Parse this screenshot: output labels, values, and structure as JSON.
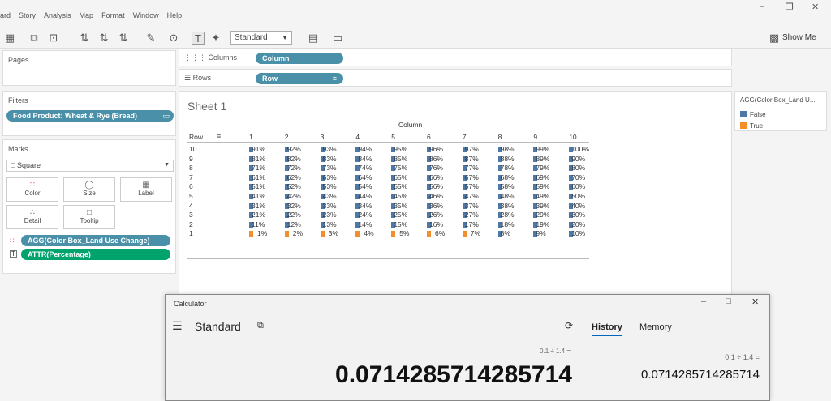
{
  "menu": [
    "ard",
    "Story",
    "Analysis",
    "Map",
    "Format",
    "Window",
    "Help"
  ],
  "toolbar": {
    "fit_value": "Standard",
    "show_me_label": "Show Me"
  },
  "pages": {
    "title": "Pages"
  },
  "shelves": {
    "columns_label": "Columns",
    "columns_pill": "Column",
    "rows_label": "Rows",
    "rows_pill": "Row"
  },
  "filters": {
    "title": "Filters",
    "pill": "Food Product: Wheat & Rye (Bread)"
  },
  "marks": {
    "title": "Marks",
    "type": "Square",
    "buttons": [
      "Color",
      "Size",
      "Label",
      "Detail",
      "Tooltip"
    ],
    "color_pill": "AGG(Color Box_Land Use Change)",
    "label_pill": "ATTR(Percentage)"
  },
  "sheet": {
    "title": "Sheet 1",
    "column_header": "Column",
    "row_header": "Row",
    "col_labels": [
      "1",
      "2",
      "3",
      "4",
      "5",
      "6",
      "7",
      "8",
      "9",
      "10"
    ],
    "row_labels": [
      "10",
      "9",
      "8",
      "7",
      "6",
      "5",
      "4",
      "3",
      "2",
      "1"
    ],
    "cells": [
      [
        "91%",
        "92%",
        "93%",
        "94%",
        "95%",
        "96%",
        "97%",
        "98%",
        "99%",
        "100%"
      ],
      [
        "81%",
        "82%",
        "83%",
        "84%",
        "85%",
        "86%",
        "87%",
        "88%",
        "89%",
        "90%"
      ],
      [
        "71%",
        "72%",
        "73%",
        "74%",
        "75%",
        "76%",
        "77%",
        "78%",
        "79%",
        "80%"
      ],
      [
        "61%",
        "62%",
        "63%",
        "64%",
        "65%",
        "66%",
        "67%",
        "68%",
        "69%",
        "70%"
      ],
      [
        "51%",
        "52%",
        "53%",
        "54%",
        "55%",
        "56%",
        "57%",
        "58%",
        "59%",
        "60%"
      ],
      [
        "41%",
        "42%",
        "43%",
        "44%",
        "45%",
        "46%",
        "47%",
        "48%",
        "49%",
        "50%"
      ],
      [
        "31%",
        "32%",
        "33%",
        "34%",
        "35%",
        "36%",
        "37%",
        "38%",
        "39%",
        "40%"
      ],
      [
        "21%",
        "22%",
        "23%",
        "24%",
        "25%",
        "26%",
        "27%",
        "28%",
        "29%",
        "30%"
      ],
      [
        "11%",
        "12%",
        "13%",
        "14%",
        "15%",
        "16%",
        "17%",
        "18%",
        "19%",
        "20%"
      ],
      [
        "1%",
        "2%",
        "3%",
        "4%",
        "5%",
        "6%",
        "7%",
        "8%",
        "9%",
        "10%"
      ]
    ],
    "true_cells_in_row_1": 7
  },
  "legend": {
    "title": "AGG(Color Box_Land U...",
    "items": [
      {
        "label": "False",
        "color": "#4e79a7"
      },
      {
        "label": "True",
        "color": "#f28e2b"
      }
    ]
  },
  "calculator": {
    "title": "Calculator",
    "mode": "Standard",
    "expression": "0.1 ÷ 1.4 =",
    "result": "0.0714285714285714",
    "tabs": [
      "History",
      "Memory"
    ],
    "history_expression": "0.1   ÷   1.4 =",
    "history_result": "0.0714285714285714"
  }
}
